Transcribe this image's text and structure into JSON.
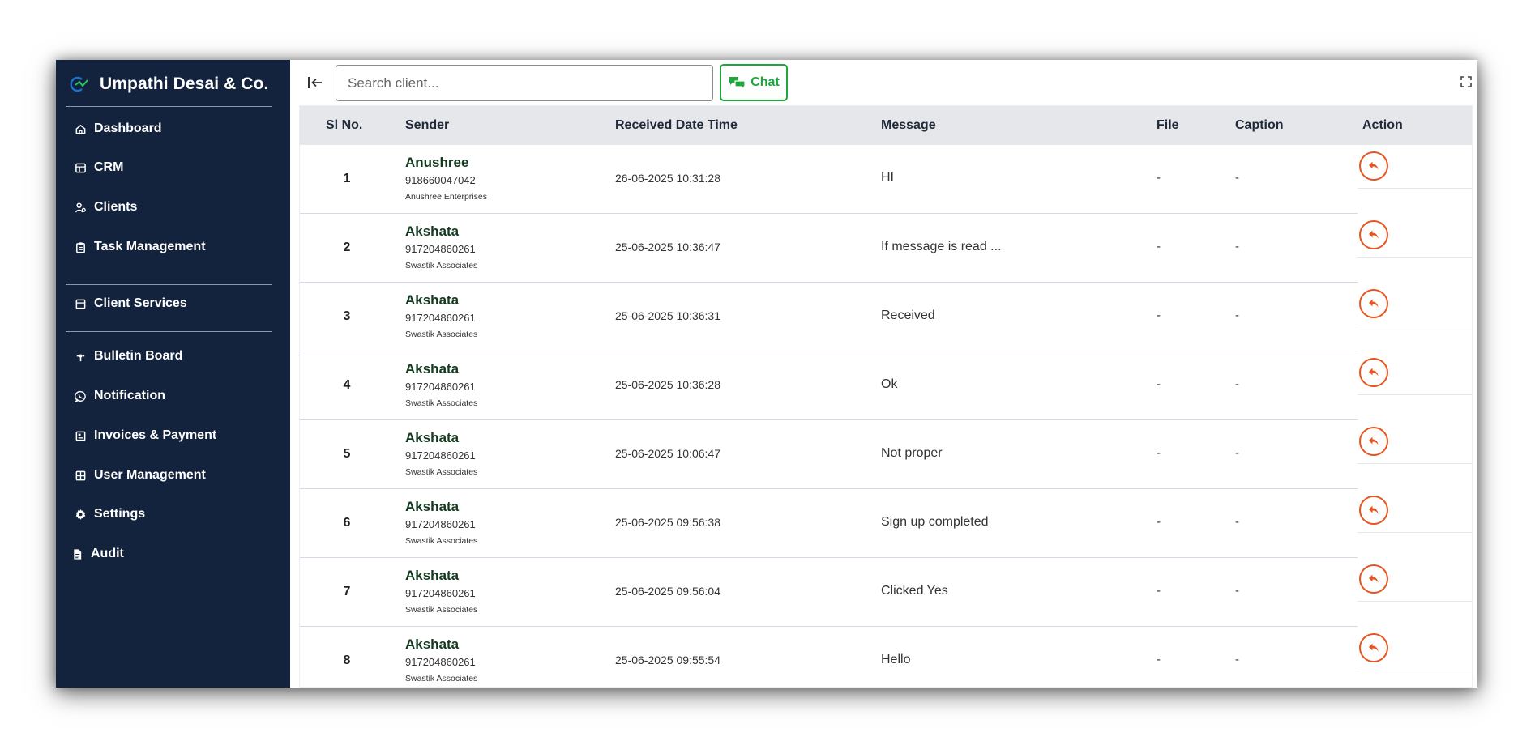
{
  "app": {
    "title": "Umpathi Desai & Co."
  },
  "sidebar": {
    "items": [
      {
        "label": "Dashboard",
        "icon": "home-icon"
      },
      {
        "label": "CRM",
        "icon": "table-icon"
      },
      {
        "label": "Clients",
        "icon": "users-icon"
      },
      {
        "label": "Task Management",
        "icon": "clipboard-icon"
      },
      {
        "label": "Client Services",
        "icon": "box-icon"
      },
      {
        "label": "Bulletin Board",
        "icon": "pin-icon"
      },
      {
        "label": "Notification",
        "icon": "whatsapp-icon"
      },
      {
        "label": "Invoices & Payment",
        "icon": "invoice-icon"
      },
      {
        "label": "User Management",
        "icon": "grid-icon"
      },
      {
        "label": "Settings",
        "icon": "gear-icon"
      },
      {
        "label": "Audit",
        "icon": "file-icon"
      }
    ]
  },
  "topbar": {
    "search_placeholder": "Search client...",
    "chat_label": "Chat"
  },
  "colors": {
    "sidebar_bg": "#14233d",
    "chat_green": "#1ea83c",
    "reply_orange": "#e8541e",
    "sender_green": "#13391f"
  },
  "table": {
    "headers": {
      "sl": "Sl No.",
      "sender": "Sender",
      "received": "Received Date Time",
      "message": "Message",
      "file": "File",
      "caption": "Caption",
      "action": "Action"
    },
    "rows": [
      {
        "sl": "1",
        "name": "Anushree",
        "phone": "918660047042",
        "company": "Anushree Enterprises",
        "date": "26-06-2025 10:31:28",
        "message": "HI",
        "file": "-",
        "caption": "-"
      },
      {
        "sl": "2",
        "name": "Akshata",
        "phone": "917204860261",
        "company": "Swastik Associates",
        "date": "25-06-2025 10:36:47",
        "message": "If message is read ...",
        "file": "-",
        "caption": "-"
      },
      {
        "sl": "3",
        "name": "Akshata",
        "phone": "917204860261",
        "company": "Swastik Associates",
        "date": "25-06-2025 10:36:31",
        "message": "Received",
        "file": "-",
        "caption": "-"
      },
      {
        "sl": "4",
        "name": "Akshata",
        "phone": "917204860261",
        "company": "Swastik Associates",
        "date": "25-06-2025 10:36:28",
        "message": "Ok",
        "file": "-",
        "caption": "-"
      },
      {
        "sl": "5",
        "name": "Akshata",
        "phone": "917204860261",
        "company": "Swastik Associates",
        "date": "25-06-2025 10:06:47",
        "message": "Not proper",
        "file": "-",
        "caption": "-"
      },
      {
        "sl": "6",
        "name": "Akshata",
        "phone": "917204860261",
        "company": "Swastik Associates",
        "date": "25-06-2025 09:56:38",
        "message": "Sign up completed",
        "file": "-",
        "caption": "-"
      },
      {
        "sl": "7",
        "name": "Akshata",
        "phone": "917204860261",
        "company": "Swastik Associates",
        "date": "25-06-2025 09:56:04",
        "message": "Clicked Yes",
        "file": "-",
        "caption": "-"
      },
      {
        "sl": "8",
        "name": "Akshata",
        "phone": "917204860261",
        "company": "Swastik Associates",
        "date": "25-06-2025 09:55:54",
        "message": "Hello",
        "file": "-",
        "caption": "-"
      }
    ]
  }
}
